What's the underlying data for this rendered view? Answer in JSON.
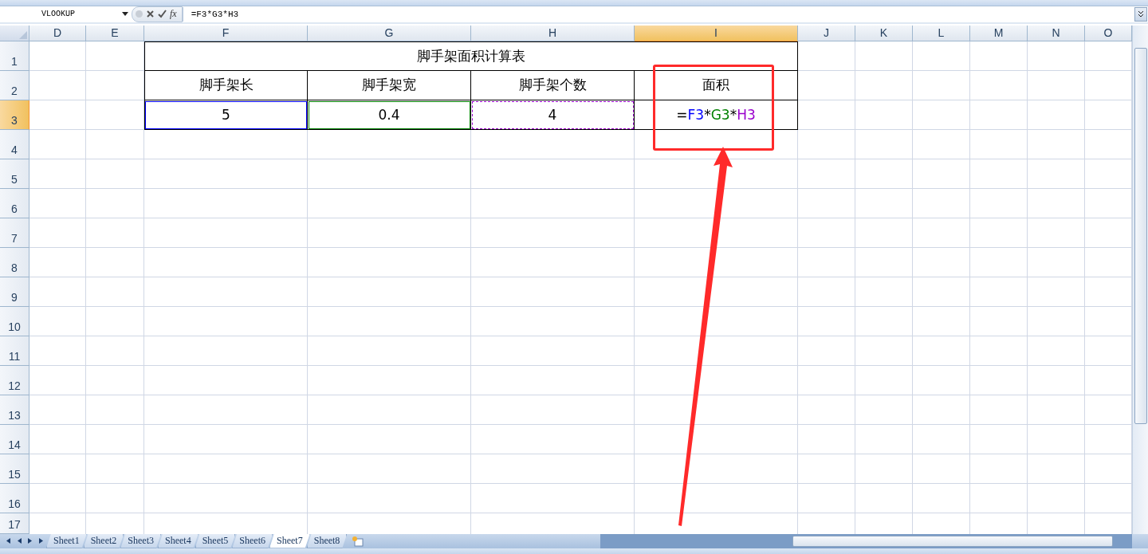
{
  "formula_bar": {
    "name_box": "VLOOKUP",
    "function_label": "fx",
    "formula": "=F3*G3*H3"
  },
  "columns": [
    {
      "label": "D",
      "selected": false
    },
    {
      "label": "E",
      "selected": false
    },
    {
      "label": "F",
      "selected": false
    },
    {
      "label": "G",
      "selected": false
    },
    {
      "label": "H",
      "selected": false
    },
    {
      "label": "I",
      "selected": true
    },
    {
      "label": "J",
      "selected": false
    },
    {
      "label": "K",
      "selected": false
    },
    {
      "label": "L",
      "selected": false
    },
    {
      "label": "M",
      "selected": false
    },
    {
      "label": "N",
      "selected": false
    },
    {
      "label": "O",
      "selected": false
    }
  ],
  "rows": [
    {
      "label": "1",
      "selected": false
    },
    {
      "label": "2",
      "selected": false
    },
    {
      "label": "3",
      "selected": true
    },
    {
      "label": "4",
      "selected": false
    },
    {
      "label": "5",
      "selected": false
    },
    {
      "label": "6",
      "selected": false
    },
    {
      "label": "7",
      "selected": false
    },
    {
      "label": "8",
      "selected": false
    },
    {
      "label": "9",
      "selected": false
    },
    {
      "label": "10",
      "selected": false
    },
    {
      "label": "11",
      "selected": false
    },
    {
      "label": "12",
      "selected": false
    },
    {
      "label": "13",
      "selected": false
    },
    {
      "label": "14",
      "selected": false
    },
    {
      "label": "15",
      "selected": false
    },
    {
      "label": "16",
      "selected": false
    },
    {
      "label": "17",
      "selected": false
    }
  ],
  "table": {
    "title": "脚手架面积计算表",
    "headers": [
      "脚手架长",
      "脚手架宽",
      "脚手架个数",
      "面积"
    ],
    "values": [
      {
        "kind": "reference",
        "text": "5",
        "color": "#0000ff"
      },
      {
        "kind": "reference",
        "text": "0.4",
        "color": "#008000"
      },
      {
        "kind": "copied_reference",
        "text": "4",
        "color": "#9900cc"
      },
      {
        "kind": "formula",
        "parts": [
          {
            "text": "="
          },
          {
            "text": "F3",
            "color": "#0000ff"
          },
          {
            "text": "*"
          },
          {
            "text": "G3",
            "color": "#008000"
          },
          {
            "text": "*"
          },
          {
            "text": "H3",
            "color": "#9900cc"
          }
        ]
      }
    ]
  },
  "sheet_tabs": [
    {
      "label": "Sheet1",
      "selected": false
    },
    {
      "label": "Sheet2",
      "selected": false
    },
    {
      "label": "Sheet3",
      "selected": false
    },
    {
      "label": "Sheet4",
      "selected": false
    },
    {
      "label": "Sheet5",
      "selected": false
    },
    {
      "label": "Sheet6",
      "selected": false
    },
    {
      "label": "Sheet7",
      "selected": true
    },
    {
      "label": "Sheet8",
      "selected": false
    }
  ]
}
